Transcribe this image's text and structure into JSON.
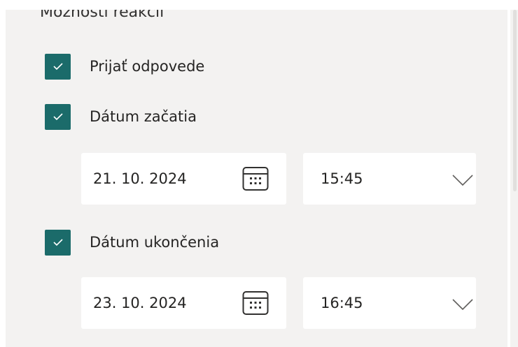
{
  "section": {
    "title": "Možnosti reakcií"
  },
  "options": {
    "accept_responses": {
      "label": "Prijať odpovede",
      "checked": true
    },
    "start_date": {
      "label": "Dátum začatia",
      "checked": true,
      "date": "21. 10. 2024",
      "time": "15:45"
    },
    "end_date": {
      "label": "Dátum ukončenia",
      "checked": true,
      "date": "23. 10. 2024",
      "time": "16:45"
    }
  },
  "icons": {
    "checkbox": "check-icon",
    "date_picker": "calendar-icon",
    "time_dropdown": "chevron-down-icon"
  },
  "colors": {
    "accent": "#1b6b6a",
    "panel_background": "#f3f2f1",
    "field_background": "#ffffff"
  }
}
